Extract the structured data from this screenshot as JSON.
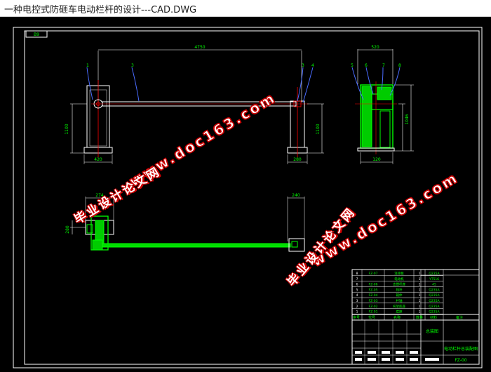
{
  "window": {
    "title": "一种电控式防砸车电动栏杆的设计---CAD.DWG"
  },
  "drawing": {
    "corner_tag": "B9",
    "dims": {
      "top_width": "4750",
      "side_width": "520",
      "left_height": "1100",
      "right_height": "1100",
      "side_height": "1046",
      "left_base": "420",
      "right_base": "280",
      "side_base": "120",
      "plan_width": "274",
      "plan_right": "240",
      "plan_side": "280"
    },
    "balloons": {
      "front": [
        "1",
        "3",
        "3",
        "4"
      ],
      "side": [
        "5",
        "6",
        "7",
        "8"
      ]
    }
  },
  "title_block": {
    "parts": [
      {
        "no": "8",
        "code": "FZ-07",
        "name": "连接板",
        "qty": "1",
        "material": "Q235A"
      },
      {
        "no": "7",
        "code": "",
        "name": "电动机",
        "qty": "1",
        "material": "YT516"
      },
      {
        "no": "6",
        "code": "FZ-06",
        "name": "支撑杆座",
        "qty": "1",
        "material": "45"
      },
      {
        "no": "5",
        "code": "FZ-05",
        "name": "挡杆",
        "qty": "1",
        "material": "Q235A"
      },
      {
        "no": "4",
        "code": "FZ-04",
        "name": "箱体",
        "qty": "1",
        "material": "Q235A"
      },
      {
        "no": "3",
        "code": "FZ-03",
        "name": "杆轴",
        "qty": "1",
        "material": "Q235A"
      },
      {
        "no": "2",
        "code": "FZ-02",
        "name": "托架底座",
        "qty": "1",
        "material": "Q235A"
      },
      {
        "no": "1",
        "code": "FZ-01",
        "name": "底座",
        "qty": "1",
        "material": "Q235A"
      }
    ],
    "header": {
      "no": "序号",
      "code": "代号",
      "name": "名称",
      "qty": "数量",
      "material": "材料",
      "note": "备注"
    },
    "drawing_name": "电动栏杆总装配图",
    "unit": "总装图",
    "drawing_no": "FZ-00"
  },
  "watermarks": {
    "url": "www.doc163.com",
    "cn": "毕业设计论文网"
  }
}
